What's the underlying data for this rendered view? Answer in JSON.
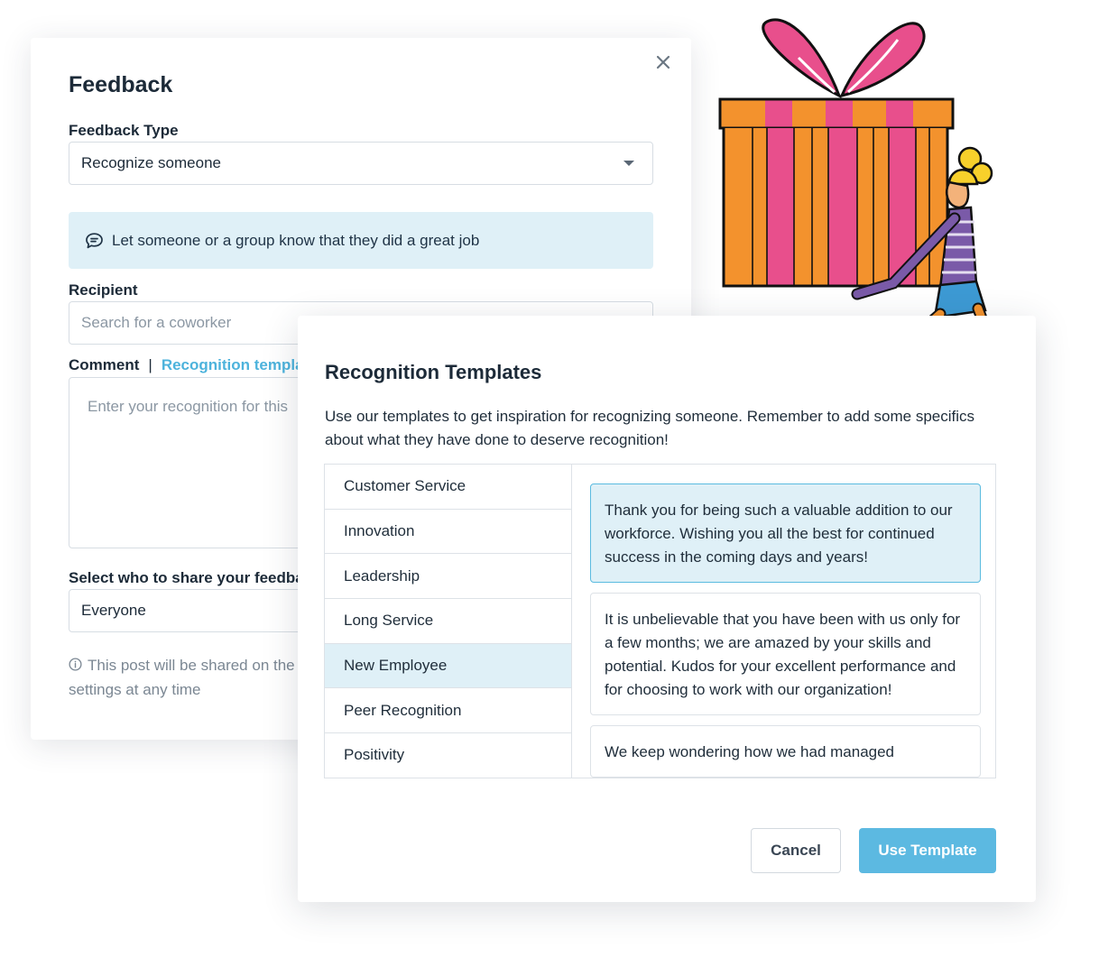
{
  "feedback": {
    "title": "Feedback",
    "type_label": "Feedback Type",
    "type_value": "Recognize someone",
    "info_text": "Let someone or a group know that they did a great job",
    "recipient_label": "Recipient",
    "recipient_placeholder": "Search for a coworker",
    "comment_label": "Comment",
    "templates_link": "Recognition templa",
    "comment_placeholder": "Enter your recognition for this",
    "share_label": "Select who to share your feedba",
    "share_value": "Everyone",
    "note_line1": "This post will be shared on the",
    "note_line2": "settings at any time"
  },
  "templates": {
    "title": "Recognition Templates",
    "description": "Use our templates to get inspiration for recognizing someone. Remember to add some specifics about what they have done to deserve recognition!",
    "categories": [
      "Customer Service",
      "Innovation",
      "Leadership",
      "Long Service",
      "New Employee",
      "Peer Recognition",
      "Positivity"
    ],
    "active_category": "New Employee",
    "cards": [
      "Thank you for being such a valuable addition to our workforce. Wishing you all the best for continued success in the coming days and years!",
      "It is unbelievable that you have been with us only for a few months; we are amazed by your skills and potential. Kudos for your excellent performance and for choosing to work with our organization!",
      "We keep wondering how we had managed"
    ],
    "cancel_label": "Cancel",
    "use_label": "Use Template"
  },
  "colors": {
    "accent": "#5cb9e1",
    "highlight": "#dff0f7",
    "gift_orange": "#f3922d",
    "gift_pink": "#e84f8c"
  }
}
